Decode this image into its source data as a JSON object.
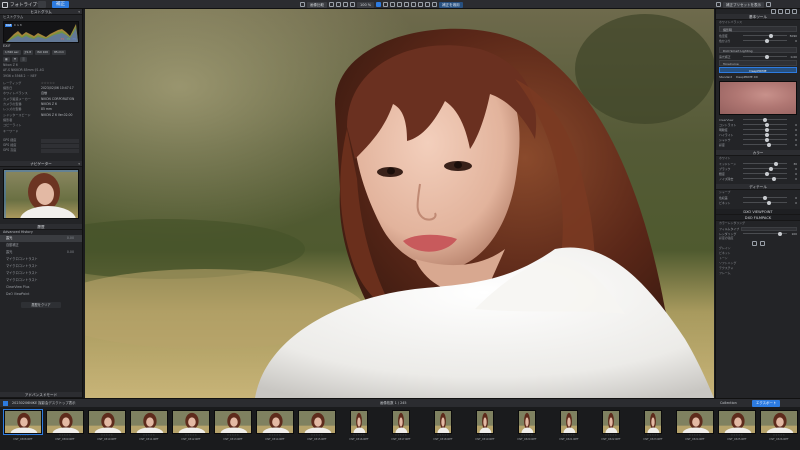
{
  "topbar": {
    "app_title": "フォトライブラリ",
    "tab_library": "",
    "tab_edit": "補正",
    "view_mode": "画像比較",
    "zoom": "100 %",
    "apply_button": "補正を適用",
    "right_actions": "補正プリセットを表示"
  },
  "left": {
    "histogram_title": "ヒストグラム",
    "histogram_sub": "ヒストグラム",
    "histogram_rgb": {
      "r": "75",
      "g": "75",
      "b": "75"
    },
    "exif": [
      {
        "k": "Nikon Z 6",
        "v": ""
      },
      {
        "k": "AF-S NIKKOR 85mm f/1.4G",
        "v": ""
      },
      {
        "k": "3936 x 5568  2 ・ NEF",
        "v": ""
      }
    ],
    "exposure_chips": [
      "1/320 sec",
      "ƒ/1.8",
      "ISO 100",
      "85 mm"
    ],
    "meta": [
      {
        "k": "レーティング",
        "v": ""
      },
      {
        "k": "撮影日",
        "v": "2023/02/06 10:47:17"
      },
      {
        "k": "ホワイトバランス",
        "v": "自動"
      },
      {
        "k": "カメラ製造メーカー",
        "v": "NIKON CORPORATION"
      },
      {
        "k": "カメラの型番",
        "v": "NIKON Z 6"
      },
      {
        "k": "レンズの型番",
        "v": "85 mm"
      },
      {
        "k": "シャッタースピード",
        "v": "NIKON Z 6 Ver.02.00"
      },
      {
        "k": "撮影者",
        "v": ""
      },
      {
        "k": "コピーライト",
        "v": ""
      },
      {
        "k": "キーワード",
        "v": ""
      }
    ],
    "gps": [
      "GPS 経度",
      "GPS 緯度",
      "GPS 高度"
    ],
    "navigator_title": "ナビゲーター",
    "history_title": "履歴",
    "history_sub": "Advanced History",
    "history_items": [
      {
        "label": "露光",
        "val": "0.00"
      },
      {
        "label": "自動補正",
        "val": ""
      },
      {
        "label": "露光",
        "val": "0.00"
      },
      {
        "label": "マイクロコントラスト",
        "val": ""
      },
      {
        "label": "マイクロコントラスト",
        "val": ""
      },
      {
        "label": "マイクロコントラスト",
        "val": ""
      },
      {
        "label": "マイクロコントラスト",
        "val": ""
      },
      {
        "label": "ClearView Plus",
        "val": ""
      },
      {
        "label": "DxO ViewPoint",
        "val": ""
      }
    ],
    "history_button": "履歴をクリア",
    "bottom_title": "アドバンスドモード"
  },
  "right": {
    "sections": {
      "basic": "基本ツール",
      "light": "DxO Smart Lighting",
      "tone": "ToneCurve",
      "skin": "肌色",
      "color": "カラー",
      "detail": "ディテール",
      "geometry": "DXO VIEWPOINT",
      "film": "DXO FILMPACK"
    },
    "wb_label": "ホワイトバランス",
    "wb_value": "撮影時",
    "sliders": [
      {
        "label": "色温度",
        "val": "5090"
      },
      {
        "label": "色かぶり",
        "val": "0"
      },
      {
        "label": "露光補正",
        "val": "0.00"
      },
      {
        "label": "ClearView",
        "val": ""
      },
      {
        "label": "コントラスト",
        "val": "0"
      },
      {
        "label": "明瞭度",
        "val": "0"
      },
      {
        "label": "ハイライト",
        "val": "0"
      },
      {
        "label": "シャドウ",
        "val": "0"
      },
      {
        "label": "彩度",
        "val": "0"
      },
      {
        "label": "自然な彩度",
        "val": "0"
      }
    ],
    "preset_modes": [
      "Standard",
      "DeepPRIME",
      "DeepPRIME XD"
    ],
    "details": [
      "ホワイト",
      "ミッドトーン",
      "ブラック",
      "輝度",
      "ノイズ除去",
      "シャープ",
      "色収差",
      "ビネット"
    ],
    "geometry_items": [
      "ボリューム変形",
      "水平補正",
      "パースペクティブ",
      "リシェイプ",
      "トリミング"
    ],
    "film_items": [
      "カラーレンダリング",
      "フィルムタイプ",
      "レンダリング",
      "彩度の強度",
      "グレイン",
      "ビネット",
      "トーン",
      "ソフトニング",
      "テクスチャ",
      "フレーム"
    ]
  },
  "filmbar": {
    "path": "20230206NIKE 撮影会デスクトップ表示",
    "count": "画像枚数 1 / 245",
    "collection": "Collection",
    "export": "エクスポート"
  },
  "filmstrip": [
    {
      "name": "DSF_0308.NEF",
      "type": "land"
    },
    {
      "name": "DSF_0309.NEF",
      "type": "land"
    },
    {
      "name": "DSF_0310.NEF",
      "type": "land"
    },
    {
      "name": "DSF_0311.NEF",
      "type": "land"
    },
    {
      "name": "DSF_0312.NEF",
      "type": "land"
    },
    {
      "name": "DSF_0313.NEF",
      "type": "land"
    },
    {
      "name": "DSF_0314.NEF",
      "type": "land"
    },
    {
      "name": "DSF_0315.NEF",
      "type": "land"
    },
    {
      "name": "DSF_0316.NEF",
      "type": "portrait"
    },
    {
      "name": "DSF_0317.NEF",
      "type": "portrait"
    },
    {
      "name": "DSF_0318.NEF",
      "type": "portrait"
    },
    {
      "name": "DSF_0319.NEF",
      "type": "portrait"
    },
    {
      "name": "DSF_0320.NEF",
      "type": "portrait"
    },
    {
      "name": "DSF_0321.NEF",
      "type": "portrait"
    },
    {
      "name": "DSF_0322.NEF",
      "type": "portrait"
    },
    {
      "name": "DSF_0323.NEF",
      "type": "portrait"
    },
    {
      "name": "DSF_0324.NEF",
      "type": "land"
    },
    {
      "name": "DSF_0325.NEF",
      "type": "land"
    },
    {
      "name": "DSF_0326.NEF",
      "type": "land"
    }
  ],
  "colors": {
    "accent": "#2d7be0",
    "panel": "#232427",
    "toolbar": "#2b2c30"
  }
}
